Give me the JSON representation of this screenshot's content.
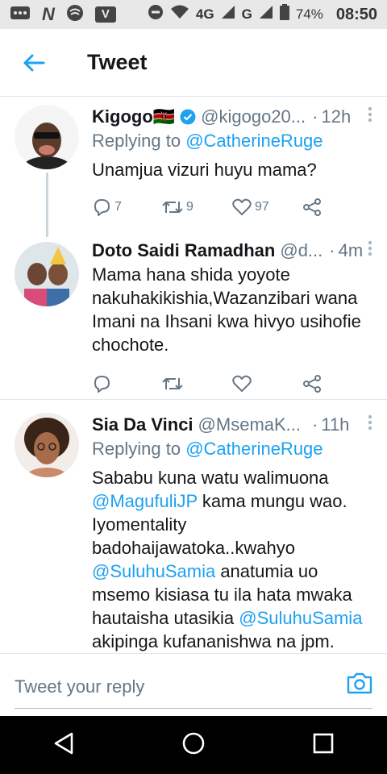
{
  "statusbar": {
    "battery": "74%",
    "time": "08:50",
    "network_1": "4G",
    "network_2": "G"
  },
  "header": {
    "title": "Tweet"
  },
  "tweets": [
    {
      "name": "Kigogo🇰🇪",
      "handle": "@kigogo20...",
      "time": "12h",
      "replying_prefix": "Replying to",
      "replying_to": "@CatherineRuge",
      "text": "Unamjua vizuri huyu mama?",
      "replies": "7",
      "retweets": "9",
      "likes": "97"
    },
    {
      "name": "Doto Saidi Ramadhan",
      "handle": "@d...",
      "time": "4m",
      "text": "Mama hana shida yoyote nakuhakikishia,Wazanzibari wana Imani na Ihsani kwa hivyo usihofie chochote."
    },
    {
      "name": "Sia Da Vinci",
      "handle": "@MsemaK...",
      "time": "11h",
      "replying_prefix": "Replying to",
      "replying_to": "@CatherineRuge",
      "text_part1": "Sababu kuna watu walimuona ",
      "mention1": "@MagufuliJP",
      "text_part2": " kama mungu wao. Iyomentality badohaijawatoka..kwahyo ",
      "mention2": "@SuluhuSamia",
      "text_part3": " anatumia uo msemo kisiasa tu ila hata mwaka hautaisha utasikia ",
      "mention3": "@SuluhuSamia",
      "text_part4": " akipinga kufananishwa na jpm."
    }
  ],
  "composer": {
    "placeholder": "Tweet your reply"
  },
  "colors": {
    "accent": "#1da1f2",
    "muted": "#657786",
    "divider": "#e1e8ed"
  }
}
